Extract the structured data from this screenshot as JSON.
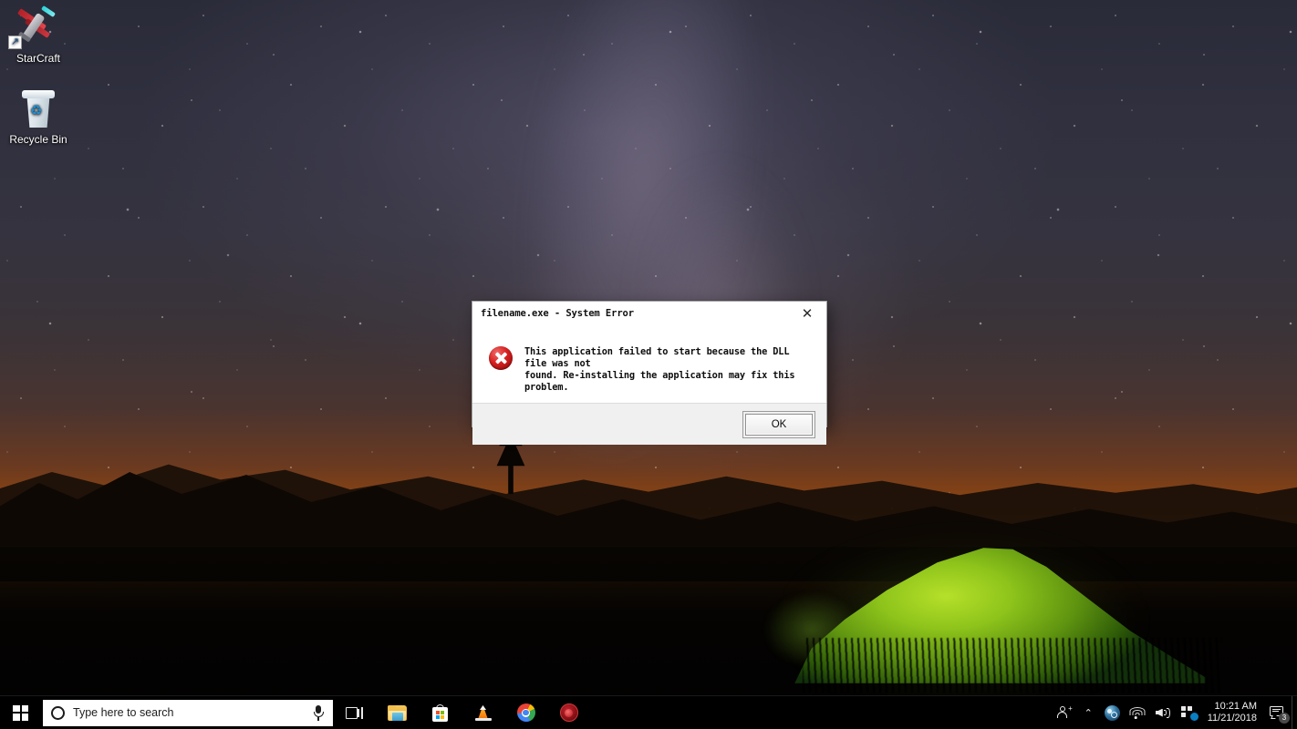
{
  "desktop": {
    "wallpaper_description": "Night sky with Milky Way over mountain silhouettes and a glowing green tent",
    "colors": {
      "sky_top": "#2a2b39",
      "sunset_glow": "#a8500c",
      "tent_green": "#8ec41b",
      "taskbar": "#000000",
      "search_bg": "#ffffff",
      "error_red": "#d92222"
    },
    "icons": [
      {
        "id": "starcraft",
        "label": "StarCraft",
        "icon": "starcraft-shortcut-icon",
        "shortcut": true,
        "shortcut_glyph": "↗"
      },
      {
        "id": "recycle-bin",
        "label": "Recycle Bin",
        "icon": "recycle-bin-icon",
        "shortcut": false,
        "glyph": "♻"
      }
    ]
  },
  "dialog": {
    "title": "filename.exe - System Error",
    "close_glyph": "✕",
    "icon": "error-icon",
    "message": "This application failed to start because the DLL file was not found. Re-installing the application may fix this problem.",
    "message_line1": "This application failed to start because the DLL file was not",
    "message_line2": "found. Re-installing the application may fix this problem.",
    "buttons": [
      {
        "id": "ok",
        "label": "OK",
        "default": true
      }
    ]
  },
  "taskbar": {
    "start": {
      "name": "start-button",
      "tooltip": "Start"
    },
    "search": {
      "placeholder": "Type here to search",
      "value": "",
      "circle_icon": "search-circle-icon",
      "mic_icon": "microphone-icon"
    },
    "task_view": {
      "label": "Task View",
      "icon": "task-view-icon"
    },
    "pinned": [
      {
        "id": "file-explorer",
        "label": "File Explorer",
        "icon": "folder-icon"
      },
      {
        "id": "microsoft-store",
        "label": "Microsoft Store",
        "icon": "store-bag-icon"
      },
      {
        "id": "vlc",
        "label": "VLC media player",
        "icon": "vlc-cone-icon"
      },
      {
        "id": "chrome",
        "label": "Google Chrome",
        "icon": "chrome-icon"
      },
      {
        "id": "red-app",
        "label": "Application",
        "icon": "red-circle-app-icon"
      }
    ],
    "tray": {
      "people": {
        "label": "People",
        "icon": "people-icon"
      },
      "show_hidden": {
        "label": "Show hidden icons",
        "glyph": "⌃"
      },
      "items": [
        {
          "id": "steam",
          "label": "Steam",
          "icon": "steam-icon"
        },
        {
          "id": "wifi",
          "label": "Network",
          "icon": "wifi-icon"
        },
        {
          "id": "volume",
          "label": "Volume",
          "icon": "speaker-icon"
        },
        {
          "id": "network-center",
          "label": "Network & Sharing",
          "icon": "network-tiles-icon"
        }
      ],
      "clock": {
        "time": "10:21 AM",
        "date": "11/21/2018"
      },
      "notifications": {
        "label": "Notifications",
        "icon": "notification-icon",
        "count": "3"
      },
      "show_desktop": {
        "label": "Show desktop"
      }
    }
  }
}
